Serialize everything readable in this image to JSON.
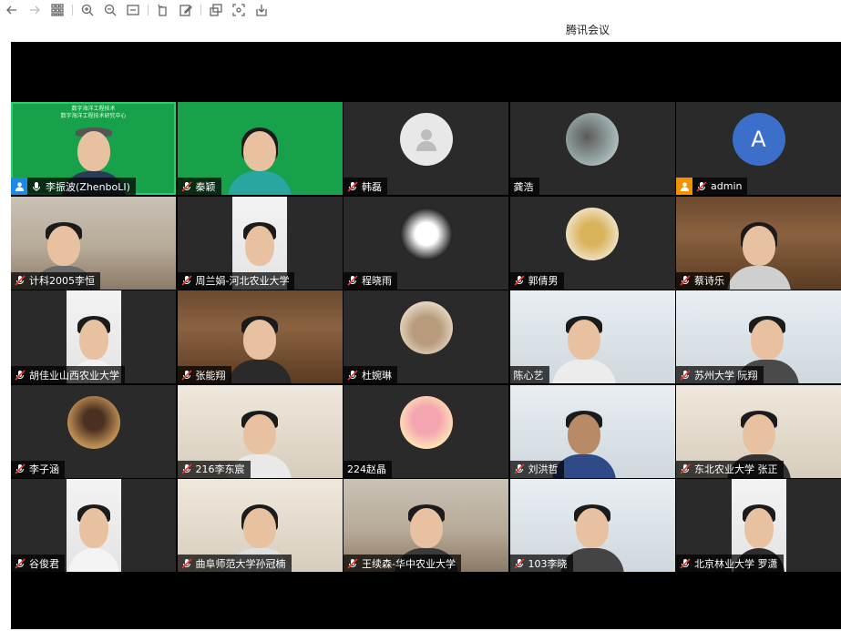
{
  "window": {
    "title": "腾讯会议"
  },
  "toolbar": {
    "icons": [
      "back-icon",
      "forward-icon",
      "grid-icon",
      "zoom-in-icon",
      "zoom-out-icon",
      "fit-icon",
      "rotate-icon",
      "edit-icon",
      "copy-icon",
      "fullscreen-icon",
      "download-icon"
    ]
  },
  "participants": [
    {
      "name": "李振波(ZhenboLI)",
      "mic": "on",
      "role": "host",
      "banner": [
        "数字海洋工程技术",
        "数字海洋工程技术研究中心"
      ]
    },
    {
      "name": "秦颖",
      "mic": "muted"
    },
    {
      "name": "韩磊",
      "mic": "muted"
    },
    {
      "name": "龚浩",
      "mic": "none"
    },
    {
      "name": "admin",
      "mic": "muted",
      "role": "cohost",
      "avatar_letter": "A"
    },
    {
      "name": "计科2005李恒",
      "mic": "muted"
    },
    {
      "name": "周兰娟-河北农业大学",
      "mic": "muted"
    },
    {
      "name": "程晓雨",
      "mic": "muted"
    },
    {
      "name": "郭倩男",
      "mic": "muted"
    },
    {
      "name": "蔡诗乐",
      "mic": "muted"
    },
    {
      "name": "胡佳业山西农业大学",
      "mic": "muted"
    },
    {
      "name": "张能翔",
      "mic": "muted"
    },
    {
      "name": "杜婉琳",
      "mic": "muted"
    },
    {
      "name": "陈心艺",
      "mic": "none"
    },
    {
      "name": "苏州大学 阮翔",
      "mic": "muted"
    },
    {
      "name": "李子涵",
      "mic": "muted"
    },
    {
      "name": "216李东宸",
      "mic": "muted"
    },
    {
      "name": "224赵晶",
      "mic": "none"
    },
    {
      "name": "刘洪哲",
      "mic": "muted"
    },
    {
      "name": "东北农业大学 张正",
      "mic": "muted"
    },
    {
      "name": "谷俊君",
      "mic": "muted"
    },
    {
      "name": "曲阜师范大学孙冠楠",
      "mic": "muted"
    },
    {
      "name": "王续森-华中农业大学",
      "mic": "muted"
    },
    {
      "name": "103李晓",
      "mic": "muted"
    },
    {
      "name": "北京林业大学 罗潇",
      "mic": "muted"
    }
  ]
}
